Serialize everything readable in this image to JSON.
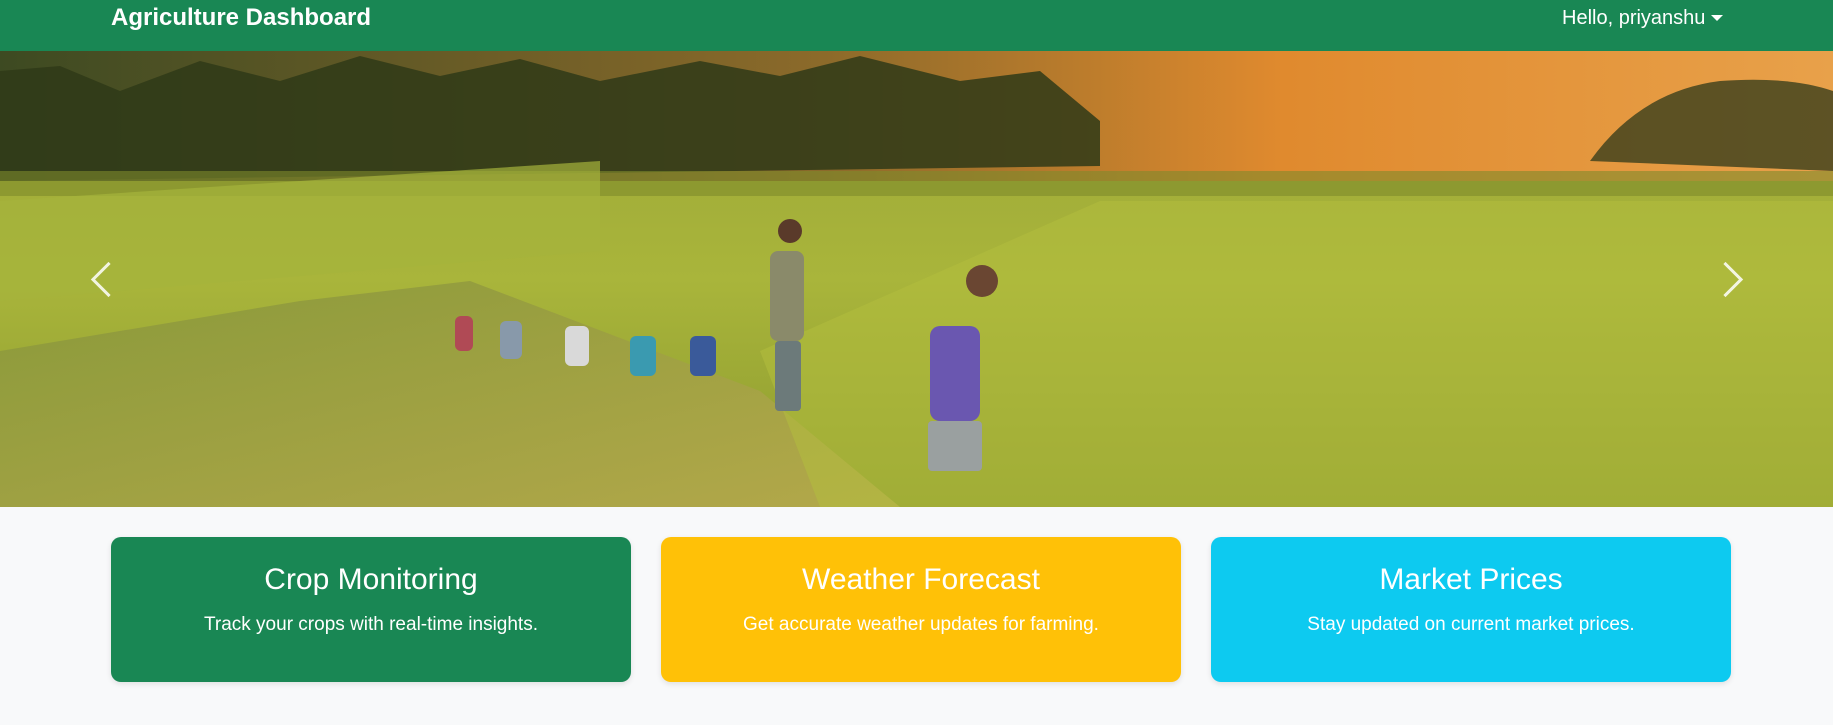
{
  "navbar": {
    "brand": "Agriculture Dashboard",
    "user_greeting": "Hello, priyanshu",
    "background_color": "#198754"
  },
  "hero": {
    "image_description_icon": "rice-field-photo",
    "prev_icon": "chevron-left-icon",
    "next_icon": "chevron-right-icon"
  },
  "cards": [
    {
      "title": "Crop Monitoring",
      "text": "Track your crops with real-time insights.",
      "color": "#198754"
    },
    {
      "title": "Weather Forecast",
      "text": "Get accurate weather updates for farming.",
      "color": "#ffc107"
    },
    {
      "title": "Market Prices",
      "text": "Stay updated on current market prices.",
      "color": "#0dcaf0"
    }
  ]
}
